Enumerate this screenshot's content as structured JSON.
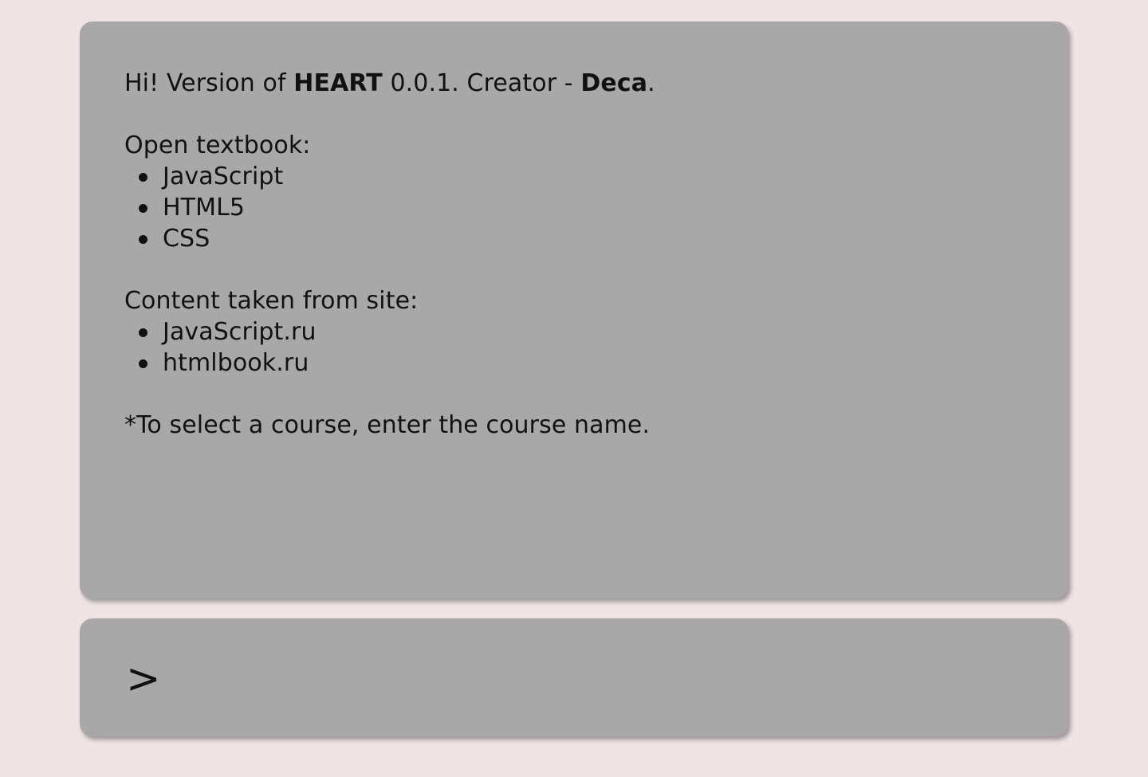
{
  "output": {
    "greeting": {
      "prefix": "Hi! Version of ",
      "app_name": "HEART",
      "middle": " 0.0.1. Creator - ",
      "creator": "Deca",
      "suffix": "."
    },
    "textbook_heading": "Open textbook:",
    "textbooks": [
      "JavaScript",
      "HTML5",
      "CSS"
    ],
    "sources_heading": "Content taken from site:",
    "sources": [
      "JavaScript.ru",
      "htmlbook.ru"
    ],
    "note": "*To select a course, enter the course name."
  },
  "input": {
    "prompt_symbol": ">",
    "value": "",
    "placeholder": ""
  }
}
